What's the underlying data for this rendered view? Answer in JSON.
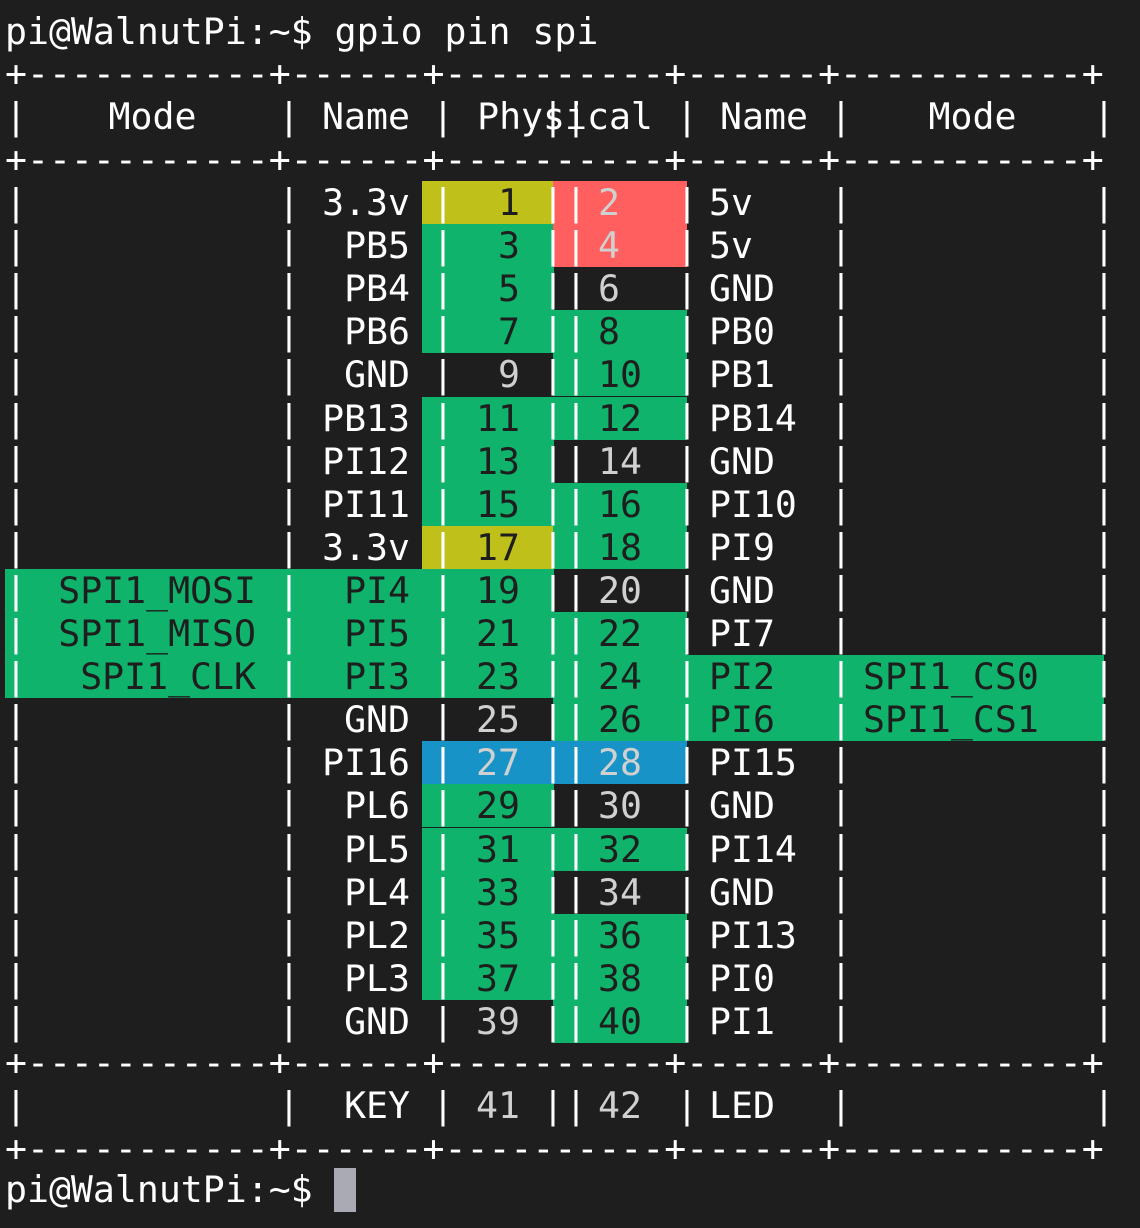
{
  "prompt": "pi@WalnutPi:~$",
  "command": "gpio pin spi",
  "header": {
    "mode_left": "Mode",
    "name_left": "Name",
    "physical": "Physical",
    "name_right": "Name",
    "mode_right": "Mode"
  },
  "colors": {
    "background": "#1e1e1e",
    "power_3v3": "#c0c01a",
    "power_5v": "#ff5f5f",
    "gpio": "#0fb36b",
    "i2c": "#1793c7",
    "text_light": "#ffffff",
    "text_dark": "#1e1e1e",
    "text_grey": "#d0d0d0"
  },
  "rows": [
    {
      "lmode": "",
      "lname": "3.3v",
      "lpin": "1",
      "rpin": "2",
      "rname": "5v",
      "rmode": "",
      "lcolor": "power_3v3",
      "rcolor": "power_5v"
    },
    {
      "lmode": "",
      "lname": "PB5",
      "lpin": "3",
      "rpin": "4",
      "rname": "5v",
      "rmode": "",
      "lcolor": "gpio",
      "rcolor": "power_5v"
    },
    {
      "lmode": "",
      "lname": "PB4",
      "lpin": "5",
      "rpin": "6",
      "rname": "GND",
      "rmode": "",
      "lcolor": "gpio",
      "rcolor": ""
    },
    {
      "lmode": "",
      "lname": "PB6",
      "lpin": "7",
      "rpin": "8",
      "rname": "PB0",
      "rmode": "",
      "lcolor": "gpio",
      "rcolor": "gpio"
    },
    {
      "lmode": "",
      "lname": "GND",
      "lpin": "9",
      "rpin": "10",
      "rname": "PB1",
      "rmode": "",
      "lcolor": "",
      "rcolor": "gpio"
    },
    {
      "lmode": "",
      "lname": "PB13",
      "lpin": "11",
      "rpin": "12",
      "rname": "PB14",
      "rmode": "",
      "lcolor": "gpio",
      "rcolor": "gpio"
    },
    {
      "lmode": "",
      "lname": "PI12",
      "lpin": "13",
      "rpin": "14",
      "rname": "GND",
      "rmode": "",
      "lcolor": "gpio",
      "rcolor": ""
    },
    {
      "lmode": "",
      "lname": "PI11",
      "lpin": "15",
      "rpin": "16",
      "rname": "PI10",
      "rmode": "",
      "lcolor": "gpio",
      "rcolor": "gpio"
    },
    {
      "lmode": "",
      "lname": "3.3v",
      "lpin": "17",
      "rpin": "18",
      "rname": "PI9",
      "rmode": "",
      "lcolor": "power_3v3",
      "rcolor": "gpio"
    },
    {
      "lmode": "SPI1_MOSI",
      "lname": "PI4",
      "lpin": "19",
      "rpin": "20",
      "rname": "GND",
      "rmode": "",
      "lcolor": "gpio",
      "rcolor": "",
      "lfull": true
    },
    {
      "lmode": "SPI1_MISO",
      "lname": "PI5",
      "lpin": "21",
      "rpin": "22",
      "rname": "PI7",
      "rmode": "",
      "lcolor": "gpio",
      "rcolor": "gpio",
      "lfull": true
    },
    {
      "lmode": "SPI1_CLK",
      "lname": "PI3",
      "lpin": "23",
      "rpin": "24",
      "rname": "PI2",
      "rmode": "SPI1_CS0",
      "lcolor": "gpio",
      "rcolor": "gpio",
      "lfull": true,
      "rfull": true
    },
    {
      "lmode": "",
      "lname": "GND",
      "lpin": "25",
      "rpin": "26",
      "rname": "PI6",
      "rmode": "SPI1_CS1",
      "lcolor": "",
      "rcolor": "gpio",
      "rfull": true
    },
    {
      "lmode": "",
      "lname": "PI16",
      "lpin": "27",
      "rpin": "28",
      "rname": "PI15",
      "rmode": "",
      "lcolor": "i2c",
      "rcolor": "i2c"
    },
    {
      "lmode": "",
      "lname": "PL6",
      "lpin": "29",
      "rpin": "30",
      "rname": "GND",
      "rmode": "",
      "lcolor": "gpio",
      "rcolor": ""
    },
    {
      "lmode": "",
      "lname": "PL5",
      "lpin": "31",
      "rpin": "32",
      "rname": "PI14",
      "rmode": "",
      "lcolor": "gpio",
      "rcolor": "gpio"
    },
    {
      "lmode": "",
      "lname": "PL4",
      "lpin": "33",
      "rpin": "34",
      "rname": "GND",
      "rmode": "",
      "lcolor": "gpio",
      "rcolor": ""
    },
    {
      "lmode": "",
      "lname": "PL2",
      "lpin": "35",
      "rpin": "36",
      "rname": "PI13",
      "rmode": "",
      "lcolor": "gpio",
      "rcolor": "gpio"
    },
    {
      "lmode": "",
      "lname": "PL3",
      "lpin": "37",
      "rpin": "38",
      "rname": "PI0",
      "rmode": "",
      "lcolor": "gpio",
      "rcolor": "gpio"
    },
    {
      "lmode": "",
      "lname": "GND",
      "lpin": "39",
      "rpin": "40",
      "rname": "PI1",
      "rmode": "",
      "lcolor": "",
      "rcolor": "gpio"
    }
  ],
  "extra_row": {
    "lmode": "",
    "lname": "KEY",
    "lpin": "41",
    "rpin": "42",
    "rname": "LED",
    "rmode": "",
    "lcolor": "",
    "rcolor": ""
  },
  "border": "+-----------+------+----------+------+-----------+"
}
